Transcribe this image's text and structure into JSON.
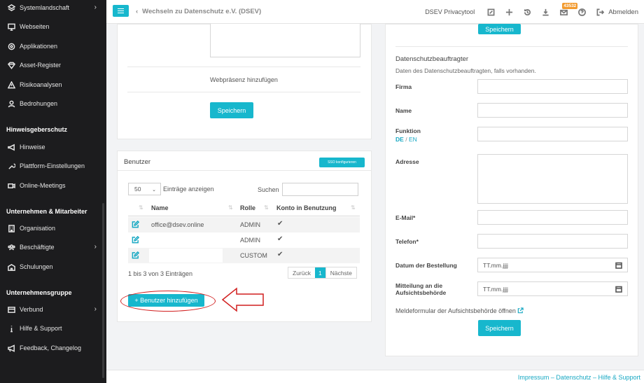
{
  "sidebar": {
    "items": [
      {
        "label": "Systemlandschaft",
        "icon": "layers-icon",
        "chevron": "›"
      },
      {
        "label": "Webseiten",
        "icon": "monitor-icon"
      },
      {
        "label": "Applikationen",
        "icon": "apps-icon"
      },
      {
        "label": "Asset-Register",
        "icon": "diamond-icon"
      },
      {
        "label": "Risikoanalysen",
        "icon": "warning-icon"
      },
      {
        "label": "Bedrohungen",
        "icon": "person-icon"
      }
    ],
    "section_hinweis": "Hinweisgeberschutz",
    "items2": [
      {
        "label": "Hinweise",
        "icon": "megaphone-icon"
      },
      {
        "label": "Plattform-Einstellungen",
        "icon": "wrench-icon"
      },
      {
        "label": "Online-Meetings",
        "icon": "video-icon"
      }
    ],
    "section_unternehmen": "Unternehmen & Mitarbeiter",
    "items3": [
      {
        "label": "Organisation",
        "icon": "building-icon"
      },
      {
        "label": "Beschäftigte",
        "icon": "users-icon",
        "chevron": "›"
      },
      {
        "label": "Schulungen",
        "icon": "school-icon"
      }
    ],
    "section_gruppe": "Unternehmensgruppe",
    "items4": [
      {
        "label": "Verbund",
        "icon": "network-icon",
        "chevron": "›"
      },
      {
        "label": "Hilfe & Support",
        "icon": "info-icon"
      },
      {
        "label": "Feedback, Changelog",
        "icon": "bullhorn-icon"
      }
    ]
  },
  "topbar": {
    "back_label": "Wechseln zu Datenschutz e.V. (DSEV)",
    "back_chevron": "‹",
    "app_name": "DSEV Privacytool",
    "badge_count": "43532",
    "logout_label": "Abmelden"
  },
  "left_card": {
    "add_web_label": "Webpräsenz hinzufügen",
    "save_label": "Speichern"
  },
  "users_card": {
    "title": "Benutzer",
    "sso_label": "SSO konfigurieren",
    "page_size": "50",
    "page_size_caret": "⌄",
    "entries_label": "Einträge anzeigen",
    "search_label": "Suchen",
    "sort_glyph": "⇅",
    "columns": [
      "Name",
      "Rolle",
      "Konto in Benutzung"
    ],
    "rows": [
      {
        "name": "office@dsev.online",
        "role": "ADMIN",
        "in_use": "✔"
      },
      {
        "name": "",
        "role": "ADMIN",
        "in_use": "✔"
      },
      {
        "name": "",
        "role": "CUSTOM",
        "in_use": "✔"
      }
    ],
    "info": "1 bis 3 von 3 Einträgen",
    "prev_label": "Zurück",
    "page": "1",
    "next_label": "Nächste",
    "add_user_label": "+ Benutzer hinzufügen"
  },
  "dpo_card": {
    "top_save_label": "Speichern",
    "title": "Datenschutzbeauftragter",
    "subtitle": "Daten des Datenschutzbeauftragten, falls vorhanden.",
    "firma_label": "Firma",
    "name_label": "Name",
    "funktion_label": "Funktion",
    "lang_de": "DE",
    "lang_sep": "/",
    "lang_en": "EN",
    "adresse_label": "Adresse",
    "email_label": "E-Mail*",
    "telefon_label": "Telefon*",
    "bestellung_label": "Datum der Bestellung",
    "bestellung_placeholder": "TT.mm.jjjj",
    "mitteilung_label_1": "Mitteilung an die",
    "mitteilung_label_2": "Aufsichtsbehörde",
    "mitteilung_placeholder": "TT.mm.jjjj",
    "meldeformular_link": "Meldeformular der Aufsichtsbehörde öffnen",
    "save_label": "Speichern"
  },
  "footer": {
    "links": "Impressum – Datenschutz – Hilfe & Support"
  },
  "colors": {
    "accent": "#17b7cd",
    "sidebar_bg": "#1c1c1e",
    "annotation_red": "#d11f1f",
    "badge": "#f29a2e"
  }
}
